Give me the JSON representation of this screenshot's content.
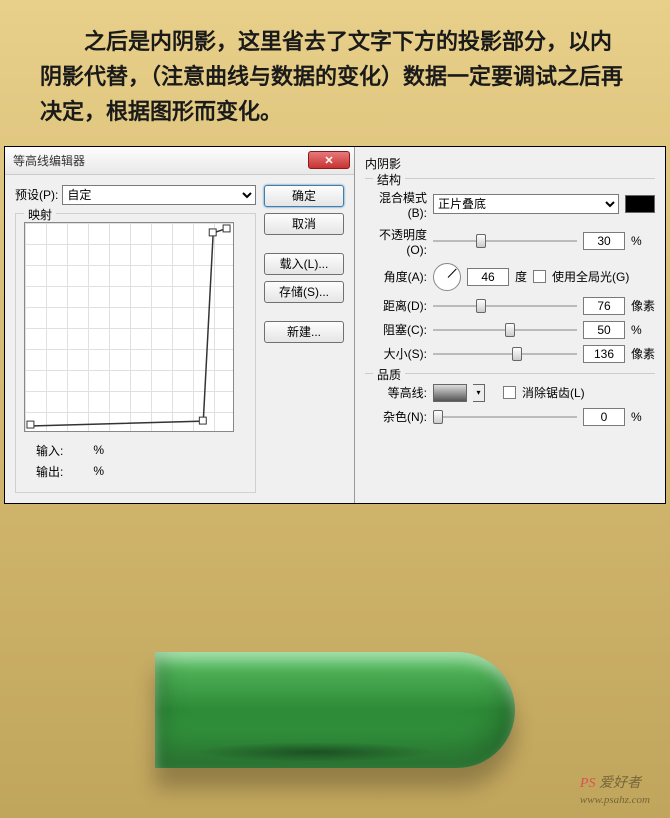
{
  "intro": "之后是内阴影，这里省去了文字下方的投影部分，以内阴影代替，（注意曲线与数据的变化）数据一定要调试之后再决定，根据图形而变化。",
  "contourEditor": {
    "title": "等高线编辑器",
    "presetLabel": "预设(P):",
    "presetValue": "自定",
    "mappingLabel": "映射",
    "inputLabel": "输入:",
    "inputUnit": "%",
    "outputLabel": "输出:",
    "outputUnit": "%",
    "buttons": {
      "ok": "确定",
      "cancel": "取消",
      "load": "载入(L)...",
      "save": "存储(S)...",
      "new": "新建..."
    }
  },
  "innerShadow": {
    "title": "内阴影",
    "structureLabel": "结构",
    "blendModeLabel": "混合模式(B):",
    "blendModeValue": "正片叠底",
    "opacityLabel": "不透明度(O):",
    "opacityValue": "30",
    "opacityUnit": "%",
    "angleLabel": "角度(A):",
    "angleValue": "46",
    "angleUnit": "度",
    "globalLightLabel": "使用全局光(G)",
    "distanceLabel": "距离(D):",
    "distanceValue": "76",
    "distanceUnit": "像素",
    "chokeLabel": "阻塞(C):",
    "chokeValue": "50",
    "chokeUnit": "%",
    "sizeLabel": "大小(S):",
    "sizeValue": "136",
    "sizeUnit": "像素",
    "qualityLabel": "品质",
    "contourLabel": "等高线:",
    "antiAliasLabel": "消除锯齿(L)",
    "noiseLabel": "杂色(N):",
    "noiseValue": "0",
    "noiseUnit": "%"
  },
  "watermark": {
    "prefix": "PS",
    "suffix": "爱好者",
    "url": "www.psahz.com"
  }
}
